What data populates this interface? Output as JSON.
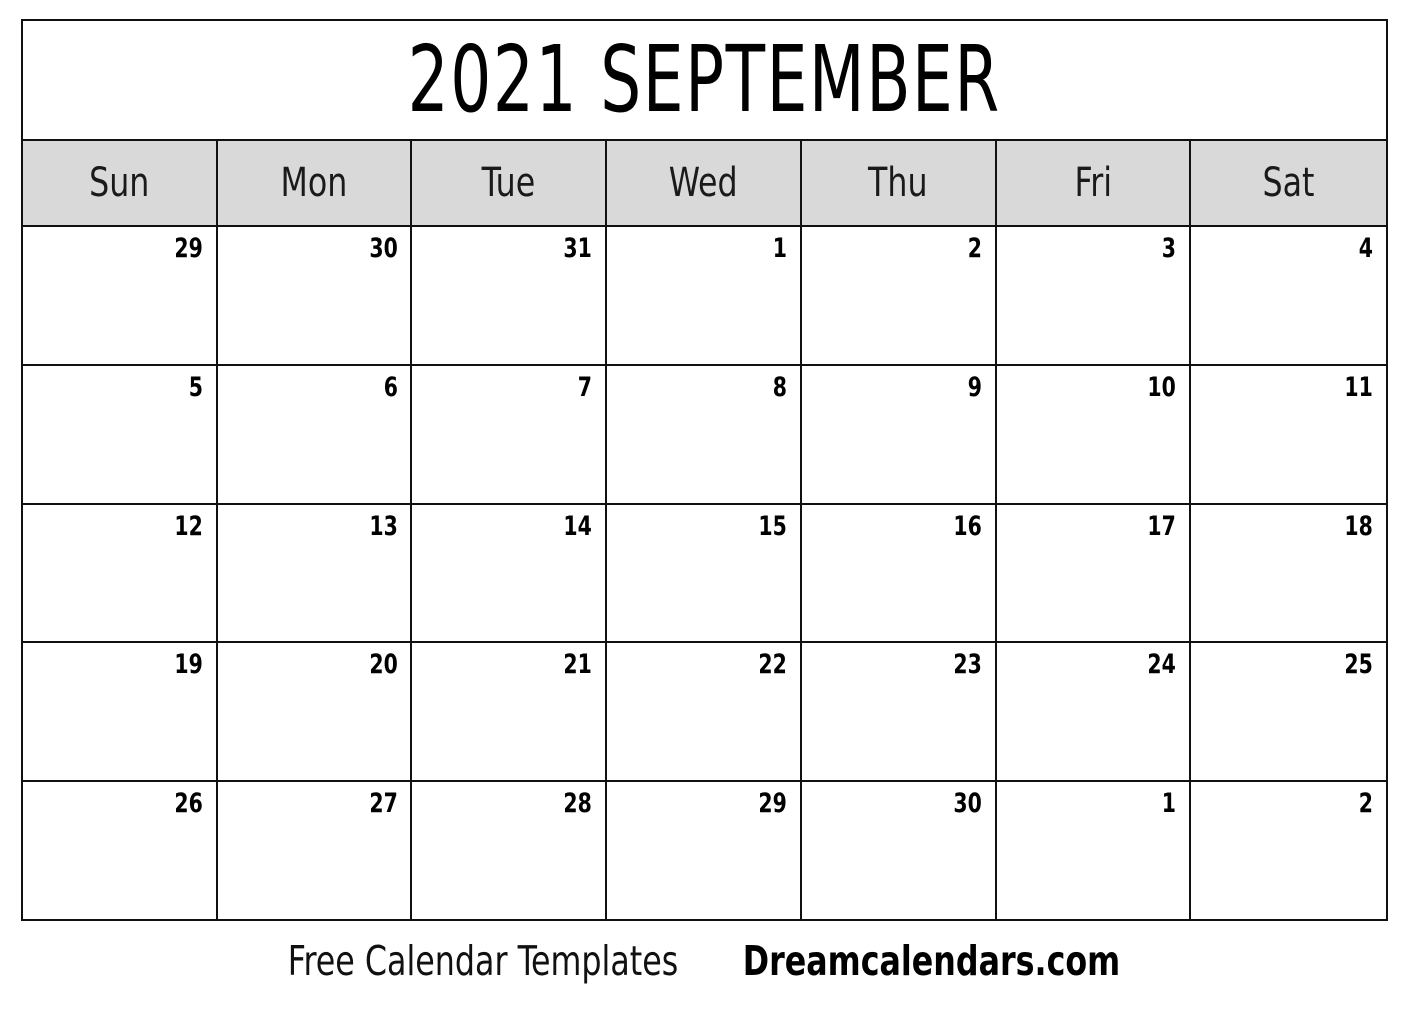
{
  "calendar": {
    "title": "2021 SEPTEMBER",
    "year": "2021",
    "month": "SEPTEMBER",
    "weekday_headers": [
      {
        "label": "Sun"
      },
      {
        "label": "Mon"
      },
      {
        "label": "Tue"
      },
      {
        "label": "Wed"
      },
      {
        "label": "Thu"
      },
      {
        "label": "Fri"
      },
      {
        "label": "Sat"
      }
    ],
    "weeks": [
      {
        "days": [
          {
            "number": "29",
            "in_month": false
          },
          {
            "number": "30",
            "in_month": false
          },
          {
            "number": "31",
            "in_month": false
          },
          {
            "number": "1",
            "in_month": true
          },
          {
            "number": "2",
            "in_month": true
          },
          {
            "number": "3",
            "in_month": true
          },
          {
            "number": "4",
            "in_month": true
          }
        ]
      },
      {
        "days": [
          {
            "number": "5",
            "in_month": true
          },
          {
            "number": "6",
            "in_month": true
          },
          {
            "number": "7",
            "in_month": true
          },
          {
            "number": "8",
            "in_month": true
          },
          {
            "number": "9",
            "in_month": true
          },
          {
            "number": "10",
            "in_month": true
          },
          {
            "number": "11",
            "in_month": true
          }
        ]
      },
      {
        "days": [
          {
            "number": "12",
            "in_month": true
          },
          {
            "number": "13",
            "in_month": true
          },
          {
            "number": "14",
            "in_month": true
          },
          {
            "number": "15",
            "in_month": true
          },
          {
            "number": "16",
            "in_month": true
          },
          {
            "number": "17",
            "in_month": true
          },
          {
            "number": "18",
            "in_month": true
          }
        ]
      },
      {
        "days": [
          {
            "number": "19",
            "in_month": true
          },
          {
            "number": "20",
            "in_month": true
          },
          {
            "number": "21",
            "in_month": true
          },
          {
            "number": "22",
            "in_month": true
          },
          {
            "number": "23",
            "in_month": true
          },
          {
            "number": "24",
            "in_month": true
          },
          {
            "number": "25",
            "in_month": true
          }
        ]
      },
      {
        "days": [
          {
            "number": "26",
            "in_month": true
          },
          {
            "number": "27",
            "in_month": true
          },
          {
            "number": "28",
            "in_month": true
          },
          {
            "number": "29",
            "in_month": true
          },
          {
            "number": "30",
            "in_month": true
          },
          {
            "number": "1",
            "in_month": false
          },
          {
            "number": "2",
            "in_month": false
          }
        ]
      }
    ]
  },
  "footer": {
    "tagline": "Free Calendar Templates",
    "brand": "Dreamcalendars.com"
  },
  "colors": {
    "header_background": "#d9d9d9",
    "grid_line": "#111111",
    "cell_background": "#ffffff",
    "text": "#000000",
    "page_background": "#ffffff"
  }
}
